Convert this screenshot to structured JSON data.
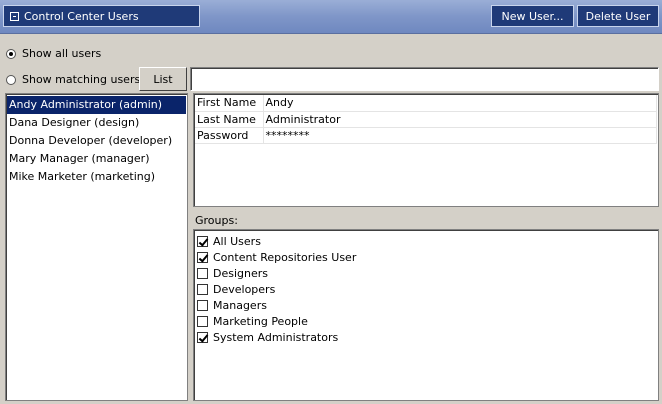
{
  "window": {
    "title": "Control Center Users"
  },
  "toolbar": {
    "new_user_label": "New User...",
    "delete_user_label": "Delete User"
  },
  "filters": {
    "show_all_label": "Show all users",
    "show_all_selected": true,
    "show_matching_label": "Show matching users:",
    "show_matching_selected": false,
    "list_button_label": "List",
    "match_value": ""
  },
  "users": [
    {
      "label": "Andy Administrator (admin)",
      "selected": true
    },
    {
      "label": "Dana Designer (design)",
      "selected": false
    },
    {
      "label": "Donna Developer (developer)",
      "selected": false
    },
    {
      "label": "Mary Manager (manager)",
      "selected": false
    },
    {
      "label": "Mike Marketer (marketing)",
      "selected": false
    }
  ],
  "properties": [
    {
      "key": "First Name",
      "value": "Andy"
    },
    {
      "key": "Last Name",
      "value": "Administrator"
    },
    {
      "key": "Password",
      "value": "********"
    }
  ],
  "groups_label": "Groups:",
  "groups": [
    {
      "label": "All Users",
      "checked": true
    },
    {
      "label": "Content Repositories User",
      "checked": true
    },
    {
      "label": "Designers",
      "checked": false
    },
    {
      "label": "Developers",
      "checked": false
    },
    {
      "label": "Managers",
      "checked": false
    },
    {
      "label": "Marketing People",
      "checked": false
    },
    {
      "label": "System Administrators",
      "checked": true
    }
  ]
}
